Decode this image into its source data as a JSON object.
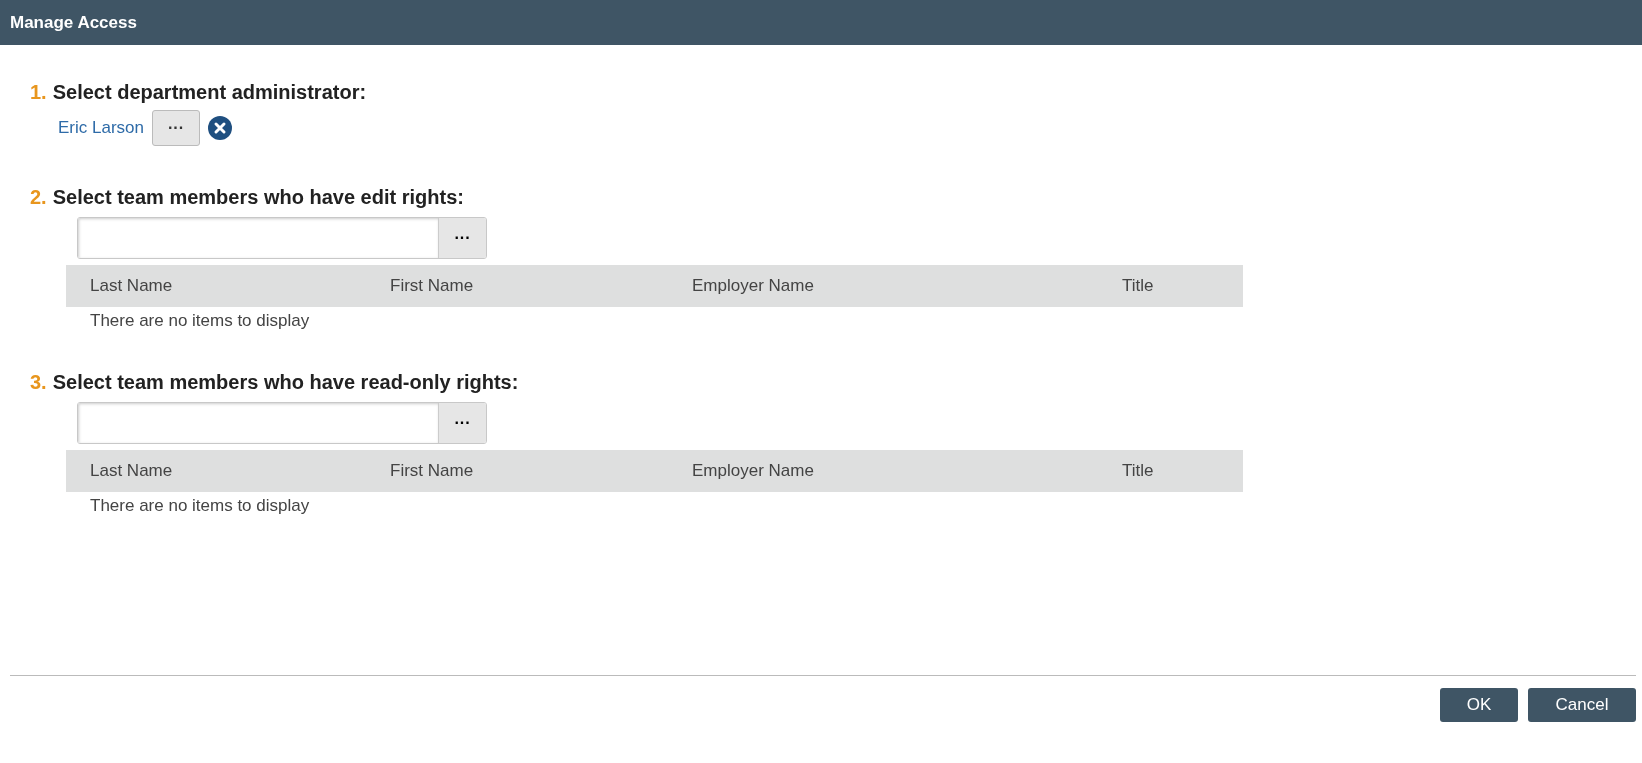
{
  "window": {
    "title": "Manage Access"
  },
  "steps": [
    {
      "kind": "person",
      "number": "1.",
      "title": "Select department administrator:",
      "person": "Eric Larson",
      "browse": "···"
    },
    {
      "kind": "list",
      "number": "2.",
      "title": "Select team members who have edit rights:",
      "browse": "···",
      "columns": [
        "Last Name",
        "First Name",
        "Employer Name",
        "Title"
      ],
      "empty": "There are no items to display"
    },
    {
      "kind": "list",
      "number": "3.",
      "title": "Select team members who have read-only rights:",
      "browse": "···",
      "columns": [
        "Last Name",
        "First Name",
        "Employer Name",
        "Title"
      ],
      "empty": "There are no items to display"
    }
  ],
  "buttons": [
    "OK",
    "Cancel"
  ]
}
